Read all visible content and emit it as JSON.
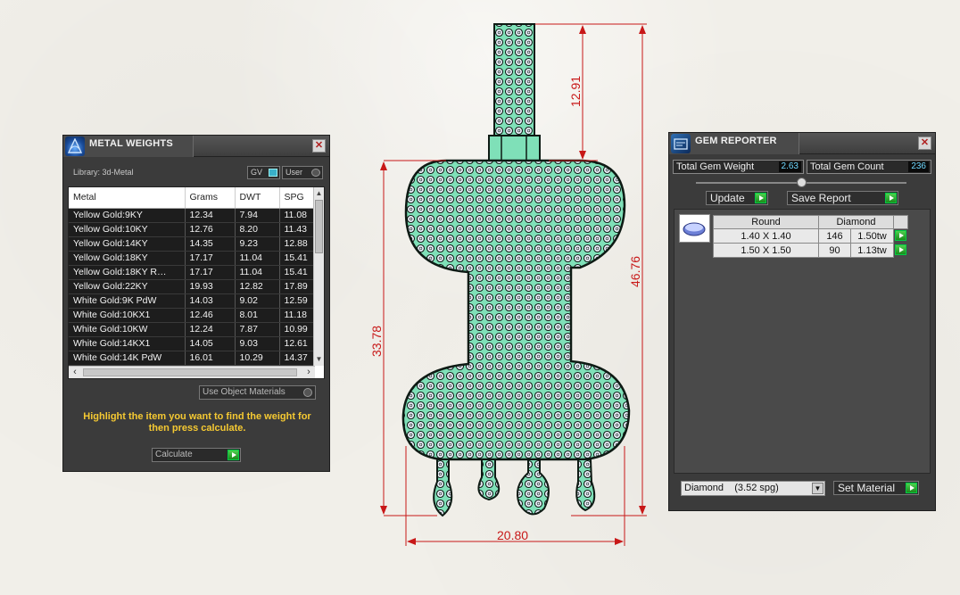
{
  "metal_weights": {
    "title": "METAL WEIGHTS",
    "library_label": "Library: 3d-Metal",
    "gv_label": "GV",
    "user_label": "User",
    "columns": [
      "Metal",
      "Grams",
      "DWT",
      "SPG"
    ],
    "rows": [
      [
        "Yellow Gold:9KY",
        "12.34",
        "7.94",
        "11.08"
      ],
      [
        "Yellow Gold:10KY",
        "12.76",
        "8.20",
        "11.43"
      ],
      [
        "Yellow Gold:14KY",
        "14.35",
        "9.23",
        "12.88"
      ],
      [
        "Yellow Gold:18KY",
        "17.17",
        "11.04",
        "15.41"
      ],
      [
        "Yellow Gold:18KY R…",
        "17.17",
        "11.04",
        "15.41"
      ],
      [
        "Yellow Gold:22KY",
        "19.93",
        "12.82",
        "17.89"
      ],
      [
        "White Gold:9K PdW",
        "14.03",
        "9.02",
        "12.59"
      ],
      [
        "White Gold:10KX1",
        "12.46",
        "8.01",
        "11.18"
      ],
      [
        "White Gold:10KW",
        "12.24",
        "7.87",
        "10.99"
      ],
      [
        "White Gold:14KX1",
        "14.05",
        "9.03",
        "12.61"
      ],
      [
        "White Gold:14K PdW",
        "16.01",
        "10.29",
        "14.37"
      ]
    ],
    "use_object_materials": "Use Object Materials",
    "hint": "Highlight the item you want to find the weight for then press calculate.",
    "calculate_label": "Calculate"
  },
  "gem_reporter": {
    "title": "GEM REPORTER",
    "total_gem_weight_label": "Total Gem Weight",
    "total_gem_weight": "2.63",
    "total_gem_count_label": "Total Gem Count",
    "total_gem_count": "236",
    "update_label": "Update",
    "save_report_label": "Save Report",
    "columns": [
      "Round",
      "Diamond"
    ],
    "rows": [
      {
        "size": "1.40 X 1.40",
        "count": "146",
        "weight": "1.50tw"
      },
      {
        "size": "1.50 X 1.50",
        "count": "90",
        "weight": "1.13tw"
      }
    ],
    "material_select": "Diamond    (3.52 spg)",
    "set_material_label": "Set Material"
  },
  "drawing": {
    "dim_bail_height": "12.91",
    "dim_total_height": "46.76",
    "dim_body_height": "33.78",
    "dim_width": "20.80",
    "colors": {
      "dimension": "#c81818",
      "metal": "#7fe0b8",
      "outline": "#0e1a14"
    }
  }
}
